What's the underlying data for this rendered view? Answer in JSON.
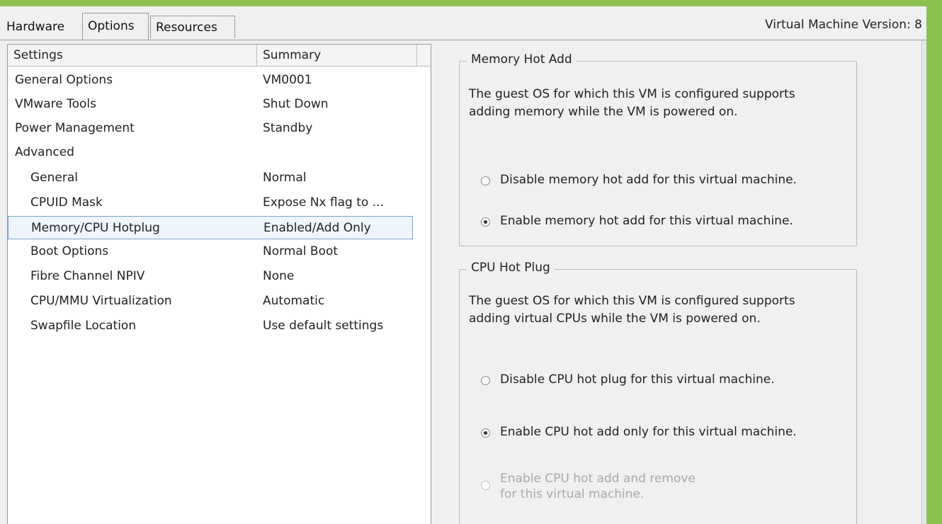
{
  "window": {
    "vm_version_text": "Virtual Machine Version: 8",
    "accent_color": "#8cc152"
  },
  "tabs": [
    {
      "label": "Hardware",
      "active": false
    },
    {
      "label": "Options",
      "active": true
    },
    {
      "label": "Resources",
      "active": false
    }
  ],
  "settings_list": {
    "columns": [
      "Settings",
      "Summary"
    ],
    "rows": [
      {
        "setting": "General Options",
        "summary": "VM0001",
        "indent": 0
      },
      {
        "setting": "VMware Tools",
        "summary": "Shut Down",
        "indent": 0
      },
      {
        "setting": "Power Management",
        "summary": "Standby",
        "indent": 0
      },
      {
        "setting": "Advanced",
        "summary": "",
        "indent": 0
      },
      {
        "setting": "General",
        "summary": "Normal",
        "indent": 1
      },
      {
        "setting": "CPUID Mask",
        "summary": "Expose Nx flag to ...",
        "indent": 1
      },
      {
        "setting": "Memory/CPU Hotplug",
        "summary": "Enabled/Add Only",
        "indent": 1,
        "selected": true
      },
      {
        "setting": "Boot Options",
        "summary": "Normal Boot",
        "indent": 1
      },
      {
        "setting": "Fibre Channel NPIV",
        "summary": "None",
        "indent": 1
      },
      {
        "setting": "CPU/MMU Virtualization",
        "summary": "Automatic",
        "indent": 1
      },
      {
        "setting": "Swapfile Location",
        "summary": "Use default settings",
        "indent": 1
      }
    ]
  },
  "memory_hot_add": {
    "title": "Memory Hot Add",
    "description": "The guest OS for which this VM is configured supports adding memory while the VM is powered on.",
    "options": [
      {
        "label": "Disable memory hot add for this virtual machine.",
        "checked": false,
        "disabled": false
      },
      {
        "label": "Enable memory hot add for this virtual machine.",
        "checked": true,
        "disabled": false
      }
    ]
  },
  "cpu_hot_plug": {
    "title": "CPU Hot Plug",
    "description": "The guest OS for which this VM is configured supports adding virtual CPUs while the VM is powered on.",
    "options": [
      {
        "label": "Disable CPU hot plug for this virtual machine.",
        "checked": false,
        "disabled": false
      },
      {
        "label": "Enable CPU hot add only for this virtual machine.",
        "checked": true,
        "disabled": false
      },
      {
        "label": "Enable CPU hot add and remove for this virtual machine.",
        "checked": false,
        "disabled": true
      }
    ]
  }
}
